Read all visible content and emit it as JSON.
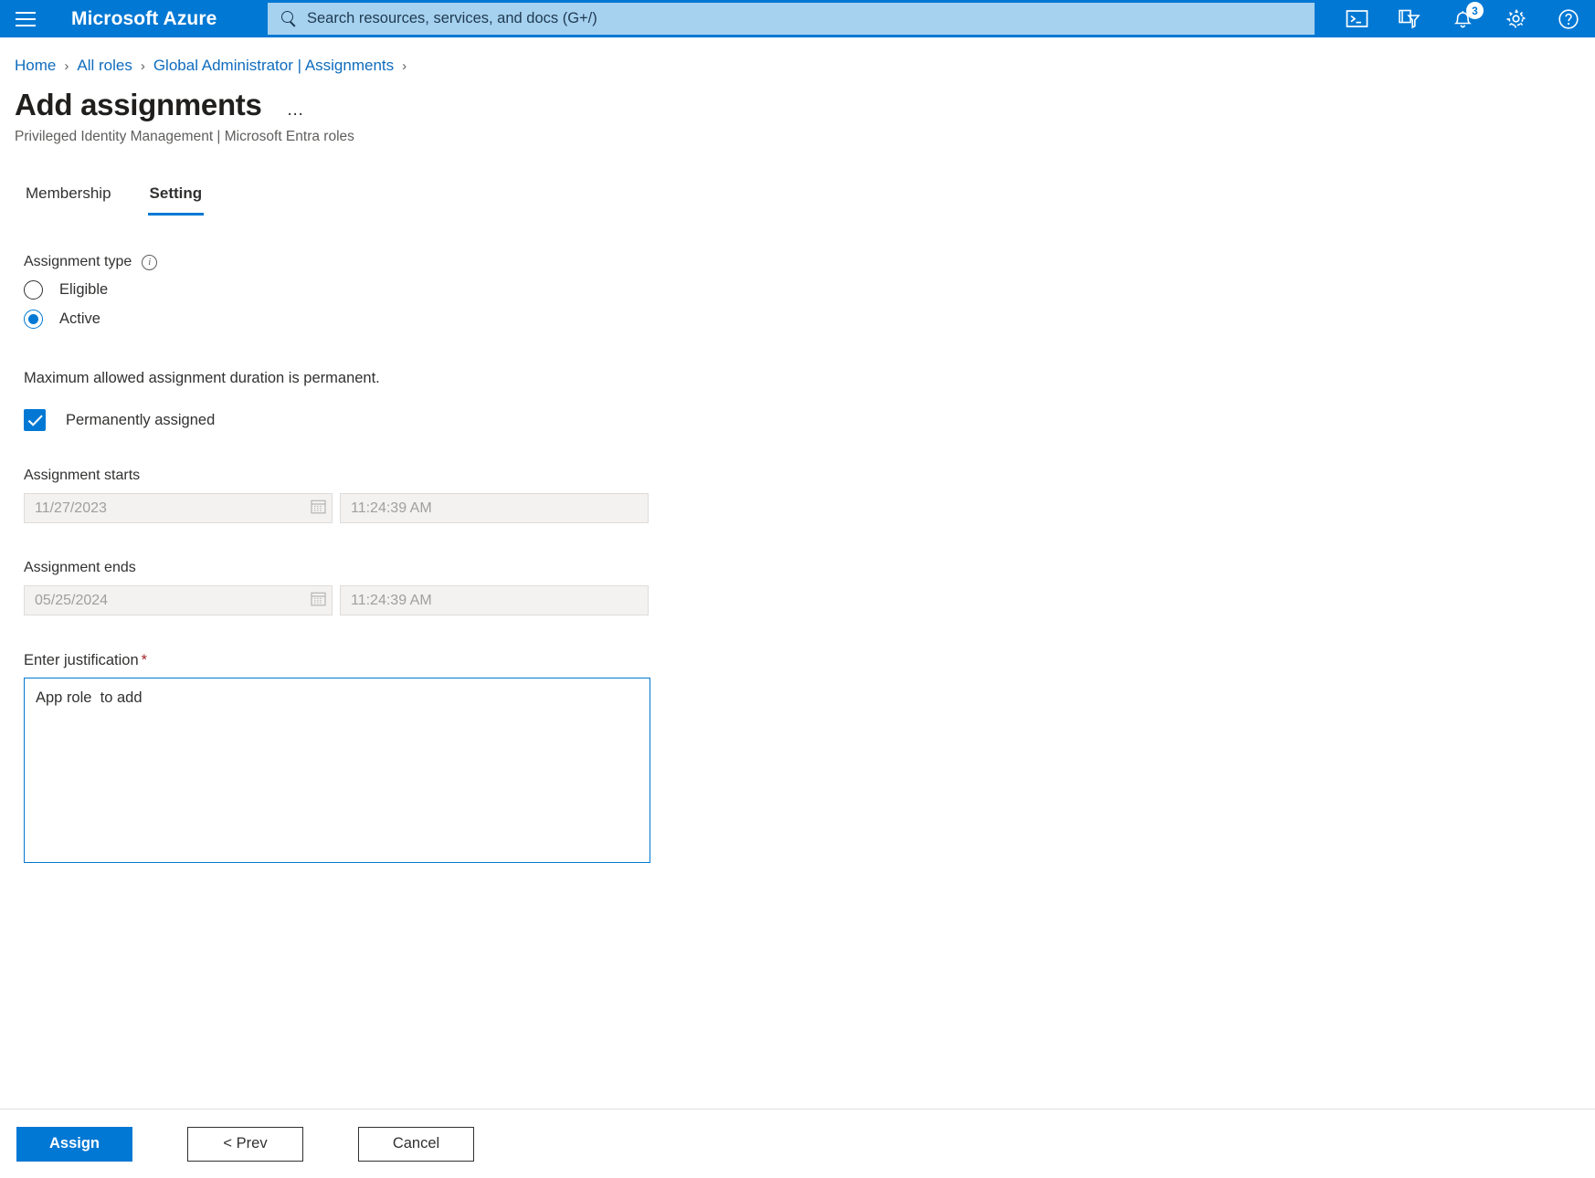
{
  "topbar": {
    "menu_icon": "hamburger-icon",
    "brand": "Microsoft Azure",
    "search": {
      "placeholder": "Search resources, services, and docs (G+/)",
      "value": "",
      "icon": "search-icon"
    },
    "icons": [
      {
        "name": "cloud-shell-icon",
        "label": "Cloud Shell"
      },
      {
        "name": "directories-filter-icon",
        "label": "Directories + subscriptions"
      },
      {
        "name": "notifications-bell-icon",
        "label": "Notifications",
        "badge": "3"
      },
      {
        "name": "settings-gear-icon",
        "label": "Settings"
      },
      {
        "name": "help-question-icon",
        "label": "Help"
      }
    ]
  },
  "breadcrumb": {
    "items": [
      {
        "label": "Home"
      },
      {
        "label": "All roles"
      },
      {
        "label": "Global Administrator | Assignments"
      }
    ],
    "separator": "›"
  },
  "header": {
    "title": "Add assignments",
    "ellipsis": "…",
    "subtitle": "Privileged Identity Management | Microsoft Entra roles"
  },
  "tabs": [
    {
      "label": "Membership",
      "active": false
    },
    {
      "label": "Setting",
      "active": true
    }
  ],
  "form": {
    "assignment_type": {
      "label": "Assignment type",
      "info_icon": "info-icon",
      "info_glyph": "i",
      "options": [
        {
          "label": "Eligible",
          "selected": false
        },
        {
          "label": "Active",
          "selected": true
        }
      ]
    },
    "duration_note": "Maximum allowed assignment duration is permanent.",
    "permanently_assigned": {
      "label": "Permanently assigned",
      "checked": true
    },
    "assignment_starts": {
      "label": "Assignment starts",
      "date_value": "11/27/2023",
      "time_value": "11:24:39 AM",
      "calendar_icon": "calendar-icon",
      "disabled": true
    },
    "assignment_ends": {
      "label": "Assignment ends",
      "date_value": "05/25/2024",
      "time_value": "11:24:39 AM",
      "calendar_icon": "calendar-icon",
      "disabled": true
    },
    "justification": {
      "label": "Enter justification",
      "required_marker": "*",
      "value": "App role  to add",
      "placeholder": ""
    }
  },
  "footer": {
    "assign_label": "Assign",
    "prev_label": "< Prev",
    "cancel_label": "Cancel"
  },
  "colors": {
    "accent": "#0078d4",
    "topbar": "#0078d4",
    "link": "#0f6cbd",
    "required": "#a4262c",
    "disabled_bg": "#f3f2f1"
  }
}
